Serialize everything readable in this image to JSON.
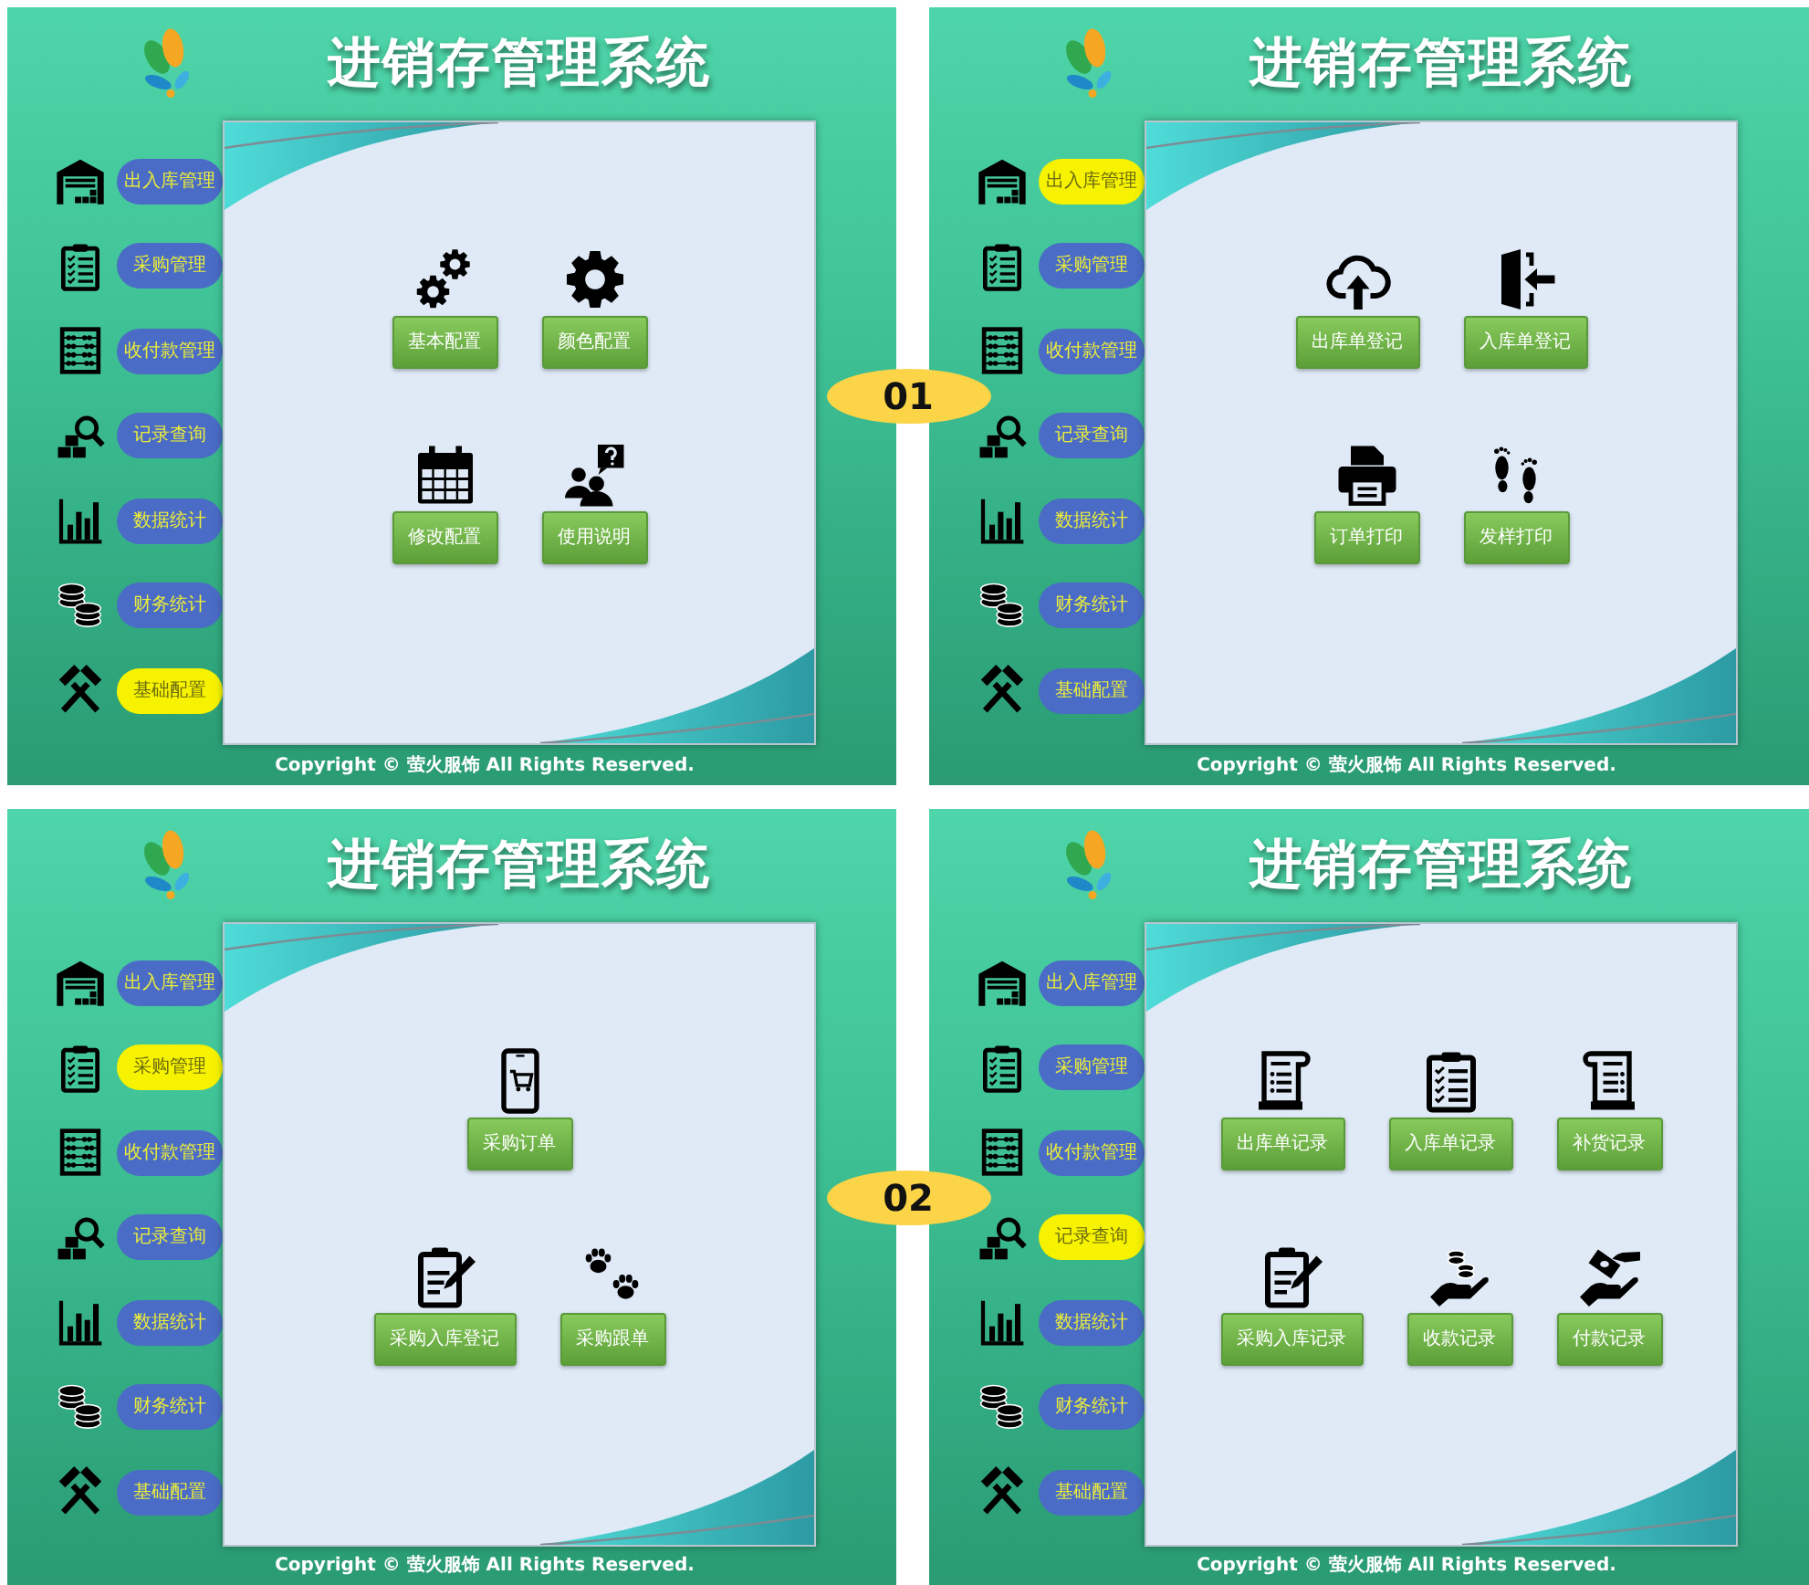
{
  "panels": [
    {
      "title": "进销存管理系统",
      "sidebar": [
        {
          "label": "出入库管理",
          "selected": false
        },
        {
          "label": "采购管理",
          "selected": false
        },
        {
          "label": "收付款管理",
          "selected": false
        },
        {
          "label": "记录查询",
          "selected": false
        },
        {
          "label": "数据统计",
          "selected": false
        },
        {
          "label": "财务统计",
          "selected": false
        },
        {
          "label": "基础配置",
          "selected": true
        }
      ],
      "tile_rows": [
        [
          "基本配置",
          "颜色配置"
        ],
        [
          "修改配置",
          "使用说明"
        ]
      ],
      "copyright": "Copyright © 萤火服饰 All Rights Reserved."
    },
    {
      "title": "进销存管理系统",
      "sidebar": [
        {
          "label": "出入库管理",
          "selected": true
        },
        {
          "label": "采购管理",
          "selected": false
        },
        {
          "label": "收付款管理",
          "selected": false
        },
        {
          "label": "记录查询",
          "selected": false
        },
        {
          "label": "数据统计",
          "selected": false
        },
        {
          "label": "财务统计",
          "selected": false
        },
        {
          "label": "基础配置",
          "selected": false
        }
      ],
      "tile_rows": [
        [
          "出库单登记",
          "入库单登记"
        ],
        [
          "订单打印",
          "发样打印"
        ]
      ],
      "copyright": "Copyright © 萤火服饰 All Rights Reserved."
    },
    {
      "title": "进销存管理系统",
      "sidebar": [
        {
          "label": "出入库管理",
          "selected": false
        },
        {
          "label": "采购管理",
          "selected": true
        },
        {
          "label": "收付款管理",
          "selected": false
        },
        {
          "label": "记录查询",
          "selected": false
        },
        {
          "label": "数据统计",
          "selected": false
        },
        {
          "label": "财务统计",
          "selected": false
        },
        {
          "label": "基础配置",
          "selected": false
        }
      ],
      "tile_rows": [
        [
          "采购订单"
        ],
        [
          "采购入库登记",
          "采购跟单"
        ]
      ],
      "copyright": "Copyright © 萤火服饰 All Rights Reserved."
    },
    {
      "title": "进销存管理系统",
      "sidebar": [
        {
          "label": "出入库管理",
          "selected": false
        },
        {
          "label": "采购管理",
          "selected": false
        },
        {
          "label": "收付款管理",
          "selected": false
        },
        {
          "label": "记录查询",
          "selected": true
        },
        {
          "label": "数据统计",
          "selected": false
        },
        {
          "label": "财务统计",
          "selected": false
        },
        {
          "label": "基础配置",
          "selected": false
        }
      ],
      "tile_rows": [
        [
          "出库单记录",
          "入库单记录",
          "补货记录"
        ],
        [
          "采购入库记录",
          "收款记录",
          "付款记录"
        ]
      ],
      "copyright": "Copyright © 萤火服饰 All Rights Reserved."
    }
  ],
  "badges": [
    {
      "label": "01"
    },
    {
      "label": "02"
    }
  ]
}
